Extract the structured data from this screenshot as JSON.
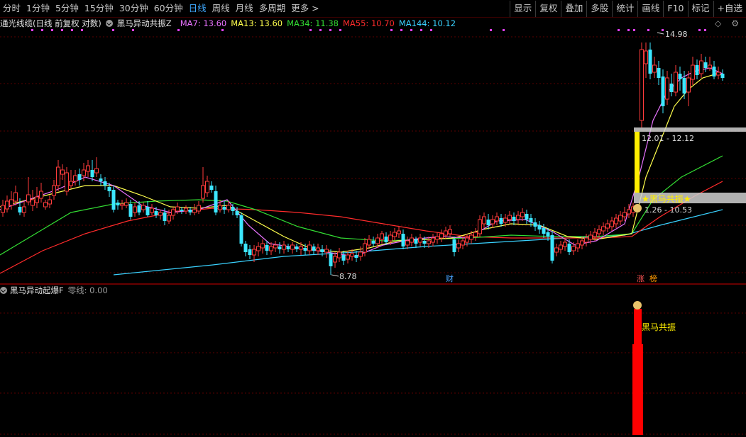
{
  "toolbar": {
    "periods": [
      "分时",
      "1分钟",
      "5分钟",
      "15分钟",
      "30分钟",
      "60分钟",
      "日线",
      "周线",
      "月线",
      "多周期",
      "更多"
    ],
    "active_period": "日线",
    "more_suffix": ">",
    "buttons": [
      "显示",
      "复权",
      "叠加",
      "多股",
      "统计",
      "画线",
      "F10",
      "标记",
      "+自选"
    ]
  },
  "legend": {
    "stock_name": "通光线缆(日线 前复权 对数)",
    "indicator": "黑马异动共振Z",
    "ma7": "MA7: 13.60",
    "ma13": "MA13: 13.60",
    "ma34": "MA34: 11.38",
    "ma55": "MA55: 10.70",
    "ma144": "MA144: 10.12",
    "right_icons": [
      "diamond-icon",
      "gear-icon"
    ]
  },
  "chart_annotations": {
    "high_label": "14.98",
    "low_label": "8.78",
    "zone_upper": "12.01 - 12.12",
    "zone_lower": "1.26 - 10.53",
    "signal_text": "★黑马共振★",
    "finance_marker": "财",
    "limit_marker": "涨",
    "rank_marker": "榜"
  },
  "indicator_panel": {
    "title": "黑马异动起爆F",
    "zero_line": "零线: 0.00",
    "signal_label": "黑马共振"
  },
  "colors": {
    "up": "#ff3b3b",
    "down": "#3ce6ff",
    "ma7": "#e873ff",
    "ma13": "#ffff4d",
    "ma34": "#33dd33",
    "ma55": "#ff2b2b",
    "ma144": "#3ad2ff",
    "toolbar_active": "#3fa9ff",
    "volume_bar": "#ff0000",
    "signal_bar": "#ffee00"
  },
  "chart_data": {
    "type": "candlestick",
    "series": [
      "MA7",
      "MA13",
      "MA34",
      "MA55",
      "MA144"
    ],
    "price_range": [
      8.78,
      14.98
    ]
  }
}
